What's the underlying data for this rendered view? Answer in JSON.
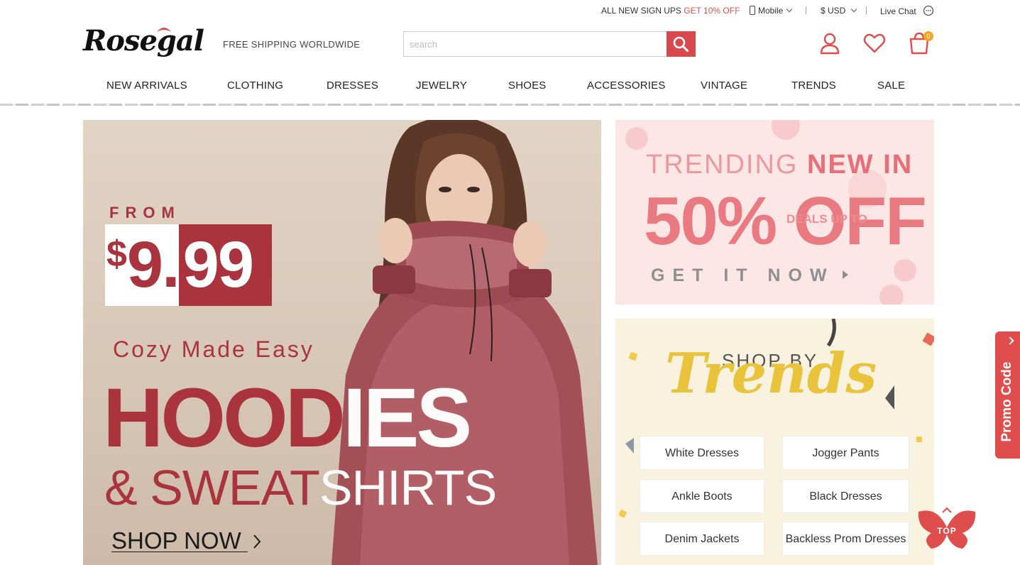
{
  "topbar": {
    "signup_text": "ALL NEW SIGN UPS",
    "signup_offer": "GET 10% OFF",
    "mobile": "Mobile",
    "currency": "$ USD",
    "live_chat": "Live Chat",
    "separator": "|"
  },
  "header": {
    "logo_text": "Rosegal",
    "tagline": "FREE SHIPPING WORLDWIDE",
    "search_placeholder": "search",
    "cart_count": "0"
  },
  "nav": {
    "items": [
      "NEW ARRIVALS",
      "CLOTHING",
      "DRESSES",
      "JEWELRY",
      "SHOES",
      "ACCESSORIES",
      "VINTAGE",
      "TRENDS",
      "SALE"
    ]
  },
  "hero": {
    "from": "FROM",
    "price_symbol": "$",
    "price_int": "9.",
    "price_dec": "99",
    "cozy": "Cozy Made Easy",
    "headline_a": "HOOD",
    "headline_b": "IES",
    "subline_a": "& SWEAT",
    "subline_b": "SHIRTS",
    "cta": "SHOP NOW"
  },
  "banner_trending": {
    "title_a": "TRENDING",
    "title_b": "NEW IN",
    "big": "50% OFF",
    "deals": "DEALS UP TO",
    "cta": "GET IT NOW",
    "colors": {
      "accent": "#e76f78",
      "bg": "#fce6e6"
    }
  },
  "banner_trends": {
    "shop_by": "SHOP BY",
    "trends": "Trends",
    "buttons": [
      "White Dresses",
      "Jogger Pants",
      "Ankle Boots",
      "Black Dresses",
      "Denim Jackets",
      "Backless Prom Dresses"
    ]
  },
  "widgets": {
    "promo_code": "Promo Code",
    "top": "TOP"
  },
  "colors": {
    "brand": "#d9484f",
    "hero_red": "#a9343e",
    "badge": "#f5a623"
  }
}
